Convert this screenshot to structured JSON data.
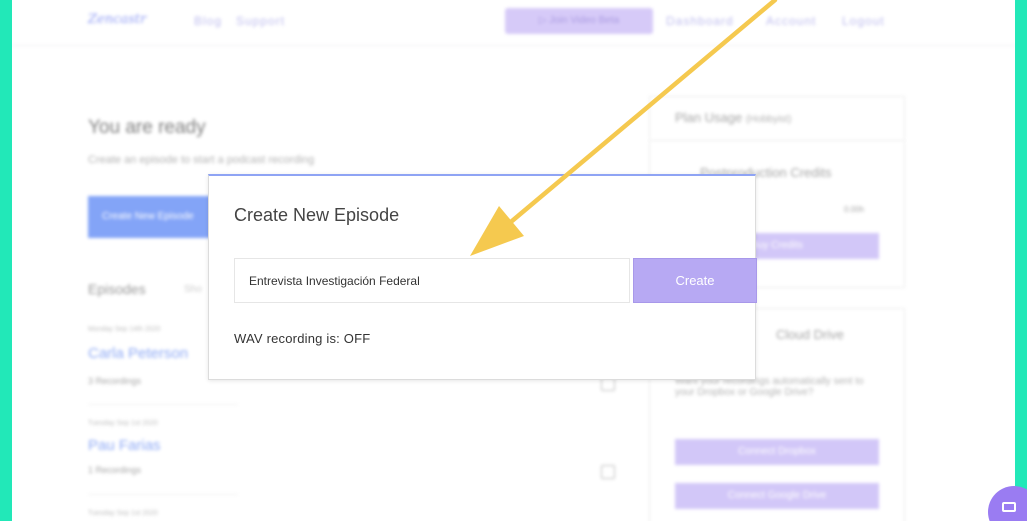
{
  "nav": {
    "logo": "Zencastr",
    "blog": "Blog",
    "support": "Support",
    "beta": "▷ Join Video Beta",
    "dashboard": "Dashboard",
    "account": "Account",
    "logout": "Logout"
  },
  "main": {
    "title": "You are ready",
    "subtitle": "Create an episode to start a podcast recording",
    "create_button": "Create New Episode",
    "episodes_heading": "Episodes",
    "episodes_sub": "Sho",
    "episodes": [
      {
        "date": "Monday Sep 14th 2020",
        "name": "Carla Peterson",
        "count": "3 Recordings"
      },
      {
        "date": "Tuesday Sep 1st 2020",
        "name": "Pau Farias",
        "count": "1 Recordings"
      },
      {
        "date": "Tuesday Sep 1st 2020"
      }
    ]
  },
  "sidebar": {
    "plan_title": "Plan Usage",
    "plan_tier": "(Hobbyist)",
    "credits_label": "Postproduction Credits",
    "credits_value": "0.00h",
    "credits_button": "Buy Credits",
    "drive_title": "Cloud Drive",
    "drive_text": "Want your recordings automatically sent to your Dropbox or Google Drive?",
    "dropbox_button": "Connect Dropbox",
    "gdrive_button": "Connect Google Drive"
  },
  "modal": {
    "title": "Create New Episode",
    "input_value": "Entrevista Investigación Federal",
    "create_button": "Create",
    "wav_status": "WAV recording is: OFF"
  },
  "colors": {
    "frame_border": "#22e8b8",
    "accent": "#b7a9f3",
    "arrow": "#f5c94f",
    "link_blue": "#6a8ef2"
  },
  "icons": [
    "calendar-icon",
    "chat-icon",
    "arrow-annotation"
  ]
}
